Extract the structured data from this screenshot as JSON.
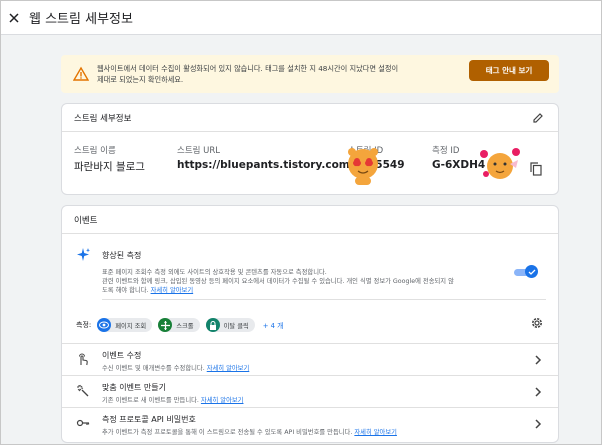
{
  "header": {
    "title": "웹 스트림 세부정보"
  },
  "alert": {
    "line1": "웹사이트에서 데이터 수집이 활성화되어 있지 않습니다. 태그를 설치한 지 48시간이 지났다면 설정이",
    "line2": "제대로 되었는지 확인하세요.",
    "button": "태그 안내 보기",
    "color": "#b06000"
  },
  "stream": {
    "section_title": "스트림 세부정보",
    "name_label": "스트림 이름",
    "name_value": "파란바지 블로그",
    "url_label": "스트림 URL",
    "url_value": "https://bluepants.tistory.com",
    "id_label": "스트림 ID",
    "id_value": "15549",
    "measurement_label": "측정 ID",
    "measurement_value": "G-6XDH4"
  },
  "events": {
    "section_title": "이벤트",
    "enhanced": {
      "title": "향상된 측정",
      "desc_line1": "표준 페이지 조회수 측정 외에도 사이트의 상호작용 및 콘텐츠를 자동으로 측정합니다.",
      "desc_line2": "관련 이벤트와 함께 링크, 삽입된 동영상 등의 페이지 요소에서 데이터가 수집될 수 있습니다. 개인 식별 정보가 Google에 전송되지 않",
      "desc_line3": "도록 해야 합니다.",
      "learn_more": "자세히 알아보기",
      "toggle_on": true,
      "measure_label": "측정:",
      "chips": [
        {
          "label": "페이지 조회",
          "color": "#1a73e8",
          "icon": "eye-icon"
        },
        {
          "label": "스크롤",
          "color": "#188038",
          "icon": "crosshair-icon"
        },
        {
          "label": "이탈 클릭",
          "color": "#12836b",
          "icon": "lock-icon"
        }
      ],
      "more": "+ 4 개"
    },
    "rows": [
      {
        "title": "이벤트 수정",
        "desc": "수신 이벤트 및 매개변수를 수정합니다.",
        "link": "자세히 알아보기"
      },
      {
        "title": "맞춤 이벤트 만들기",
        "desc": "기존 이벤트로 새 이벤트를 만듭니다.",
        "link": "자세히 알아보기"
      },
      {
        "title": "측정 프로토콜 API 비밀번호",
        "desc": "추가 이벤트가 측정 프로토콜을 통해 이 스트림으로 전송될 수 있도록 API 비밀번호를 만듭니다.",
        "link": "자세히 알아보기"
      }
    ]
  }
}
